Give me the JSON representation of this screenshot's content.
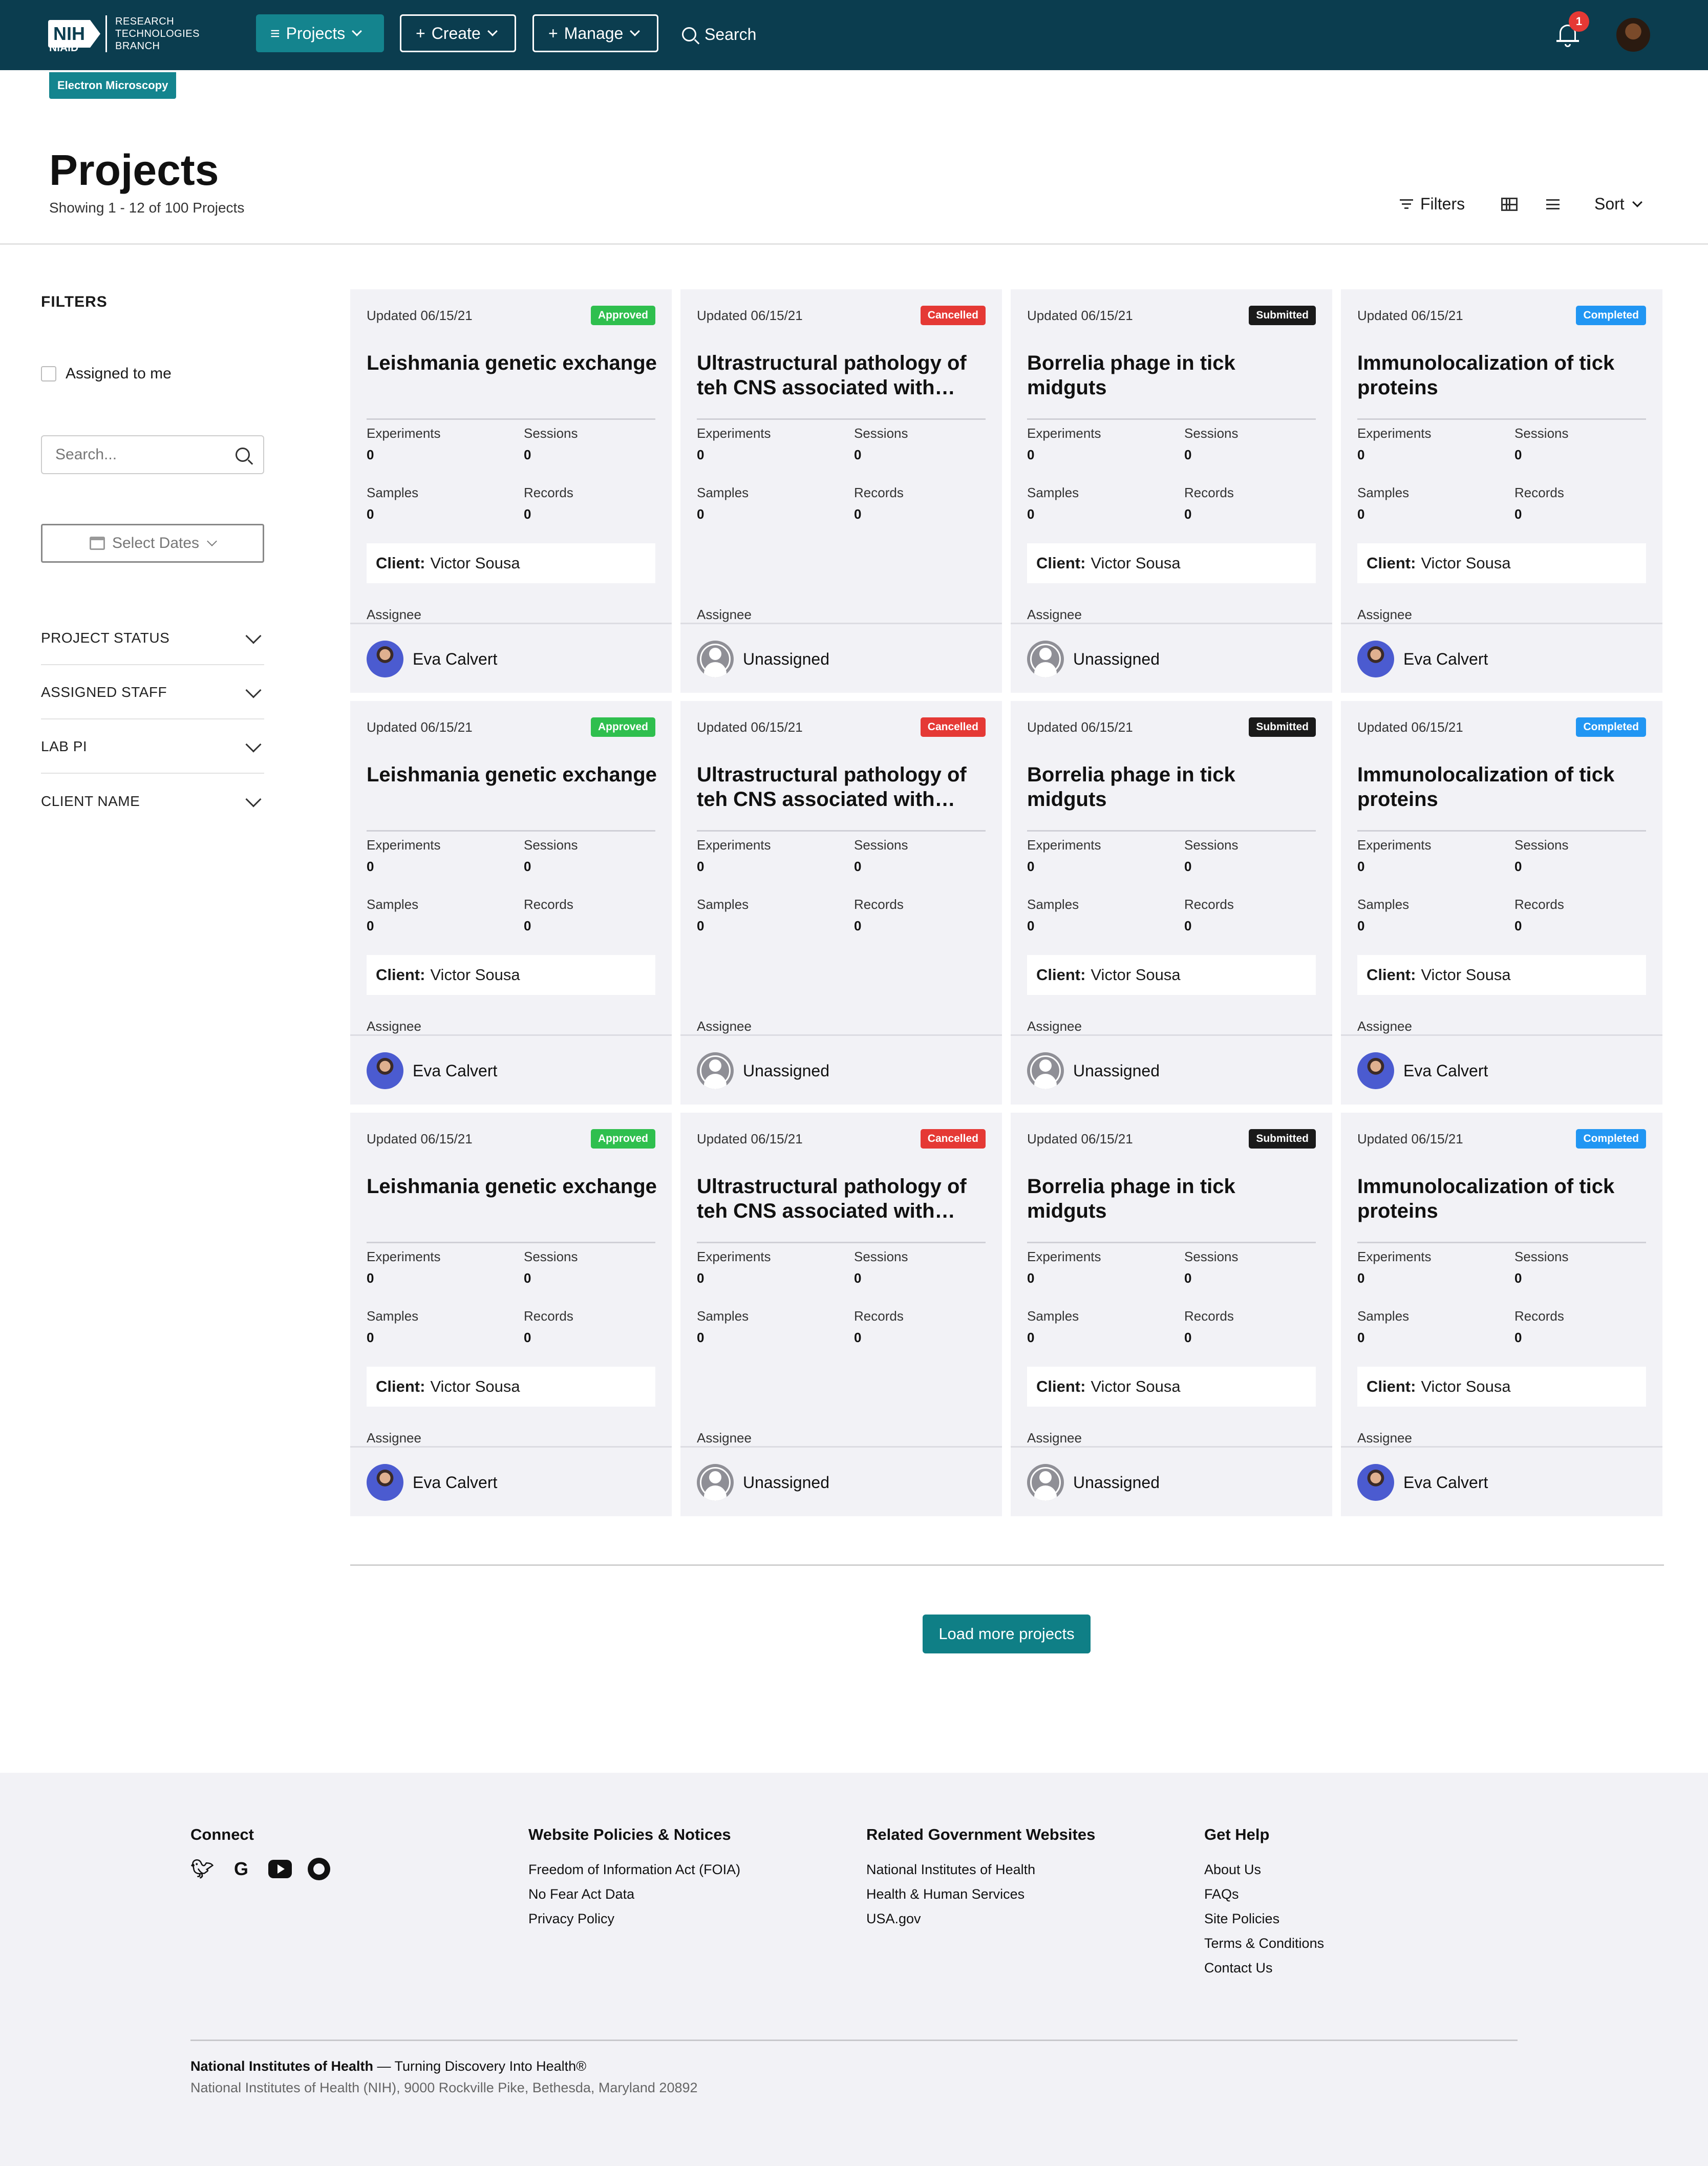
{
  "header": {
    "logo_mark": "NIH",
    "logo_sub": "NIAID",
    "logo_text": [
      "RESEARCH",
      "TECHNOLOGIES",
      "BRANCH"
    ],
    "nav": {
      "projects": "Projects",
      "create": "Create",
      "manage": "Manage",
      "search": "Search"
    },
    "notification_count": "1",
    "section_tag": "Electron Microscopy"
  },
  "page": {
    "title": "Projects",
    "subtitle": "Showing 1 - 12 of 100 Projects",
    "filters_label": "Filters",
    "sort_label": "Sort"
  },
  "sidebar": {
    "heading": "FILTERS",
    "assigned_to_me": "Assigned to me",
    "search_placeholder": "Search...",
    "select_dates": "Select Dates",
    "accordions": [
      "PROJECT STATUS",
      "ASSIGNED STAFF",
      "LAB PI",
      "CLIENT NAME"
    ]
  },
  "labels": {
    "experiments": "Experiments",
    "sessions": "Sessions",
    "samples": "Samples",
    "records": "Records",
    "client": "Client:",
    "assignee": "Assignee"
  },
  "status_colors": {
    "Approved": "#2fbf4e",
    "Cancelled": "#e53935",
    "Submitted": "#1a1a1a",
    "Completed": "#2196f3"
  },
  "projects": [
    {
      "updated": "Updated 06/15/21",
      "status": "Approved",
      "title": "Leishmania genetic exchange",
      "experiments": "0",
      "sessions": "0",
      "samples": "0",
      "records": "0",
      "client": "Victor Sousa",
      "assignee": "Eva Calvert"
    },
    {
      "updated": "Updated 06/15/21",
      "status": "Cancelled",
      "title": "Ultrastructural pathology of teh CNS associated with human…",
      "experiments": "0",
      "sessions": "0",
      "samples": "0",
      "records": "0",
      "client": "",
      "assignee": "Unassigned"
    },
    {
      "updated": "Updated 06/15/21",
      "status": "Submitted",
      "title": "Borrelia phage in tick midguts",
      "experiments": "0",
      "sessions": "0",
      "samples": "0",
      "records": "0",
      "client": "Victor Sousa",
      "assignee": "Unassigned"
    },
    {
      "updated": "Updated 06/15/21",
      "status": "Completed",
      "title": "Immunolocalization of tick proteins",
      "experiments": "0",
      "sessions": "0",
      "samples": "0",
      "records": "0",
      "client": "Victor Sousa",
      "assignee": "Eva Calvert"
    },
    {
      "updated": "Updated 06/15/21",
      "status": "Approved",
      "title": "Leishmania genetic exchange",
      "experiments": "0",
      "sessions": "0",
      "samples": "0",
      "records": "0",
      "client": "Victor Sousa",
      "assignee": "Eva Calvert"
    },
    {
      "updated": "Updated 06/15/21",
      "status": "Cancelled",
      "title": "Ultrastructural pathology of teh CNS associated with human…",
      "experiments": "0",
      "sessions": "0",
      "samples": "0",
      "records": "0",
      "client": "",
      "assignee": "Unassigned"
    },
    {
      "updated": "Updated 06/15/21",
      "status": "Submitted",
      "title": "Borrelia phage in tick midguts",
      "experiments": "0",
      "sessions": "0",
      "samples": "0",
      "records": "0",
      "client": "Victor Sousa",
      "assignee": "Unassigned"
    },
    {
      "updated": "Updated 06/15/21",
      "status": "Completed",
      "title": "Immunolocalization of tick proteins",
      "experiments": "0",
      "sessions": "0",
      "samples": "0",
      "records": "0",
      "client": "Victor Sousa",
      "assignee": "Eva Calvert"
    },
    {
      "updated": "Updated 06/15/21",
      "status": "Approved",
      "title": "Leishmania genetic exchange",
      "experiments": "0",
      "sessions": "0",
      "samples": "0",
      "records": "0",
      "client": "Victor Sousa",
      "assignee": "Eva Calvert"
    },
    {
      "updated": "Updated 06/15/21",
      "status": "Cancelled",
      "title": "Ultrastructural pathology of teh CNS associated with human…",
      "experiments": "0",
      "sessions": "0",
      "samples": "0",
      "records": "0",
      "client": "",
      "assignee": "Unassigned"
    },
    {
      "updated": "Updated 06/15/21",
      "status": "Submitted",
      "title": "Borrelia phage in tick midguts",
      "experiments": "0",
      "sessions": "0",
      "samples": "0",
      "records": "0",
      "client": "Victor Sousa",
      "assignee": "Unassigned"
    },
    {
      "updated": "Updated 06/15/21",
      "status": "Completed",
      "title": "Immunolocalization of tick proteins",
      "experiments": "0",
      "sessions": "0",
      "samples": "0",
      "records": "0",
      "client": "Victor Sousa",
      "assignee": "Eva Calvert"
    }
  ],
  "load_more": "Load more projects",
  "footer": {
    "connect": {
      "heading": "Connect",
      "icons": [
        "twitter-icon",
        "google-icon",
        "youtube-icon",
        "github-icon"
      ]
    },
    "policies": {
      "heading": "Website Policies & Notices",
      "links": [
        "Freedom of Information Act (FOIA)",
        "No Fear Act Data",
        "Privacy Policy"
      ]
    },
    "related": {
      "heading": "Related Government Websites",
      "links": [
        "National Institutes of Health",
        "Health & Human Services",
        "USA.gov"
      ]
    },
    "help": {
      "heading": "Get Help",
      "links": [
        "About Us",
        "FAQs",
        "Site Policies",
        "Terms & Conditions",
        "Contact Us"
      ]
    },
    "org_name": "National Institutes of Health",
    "tagline": " — Turning Discovery Into Health®",
    "address": "National Institutes of Health (NIH), 9000 Rockville Pike, Bethesda, Maryland 20892"
  }
}
